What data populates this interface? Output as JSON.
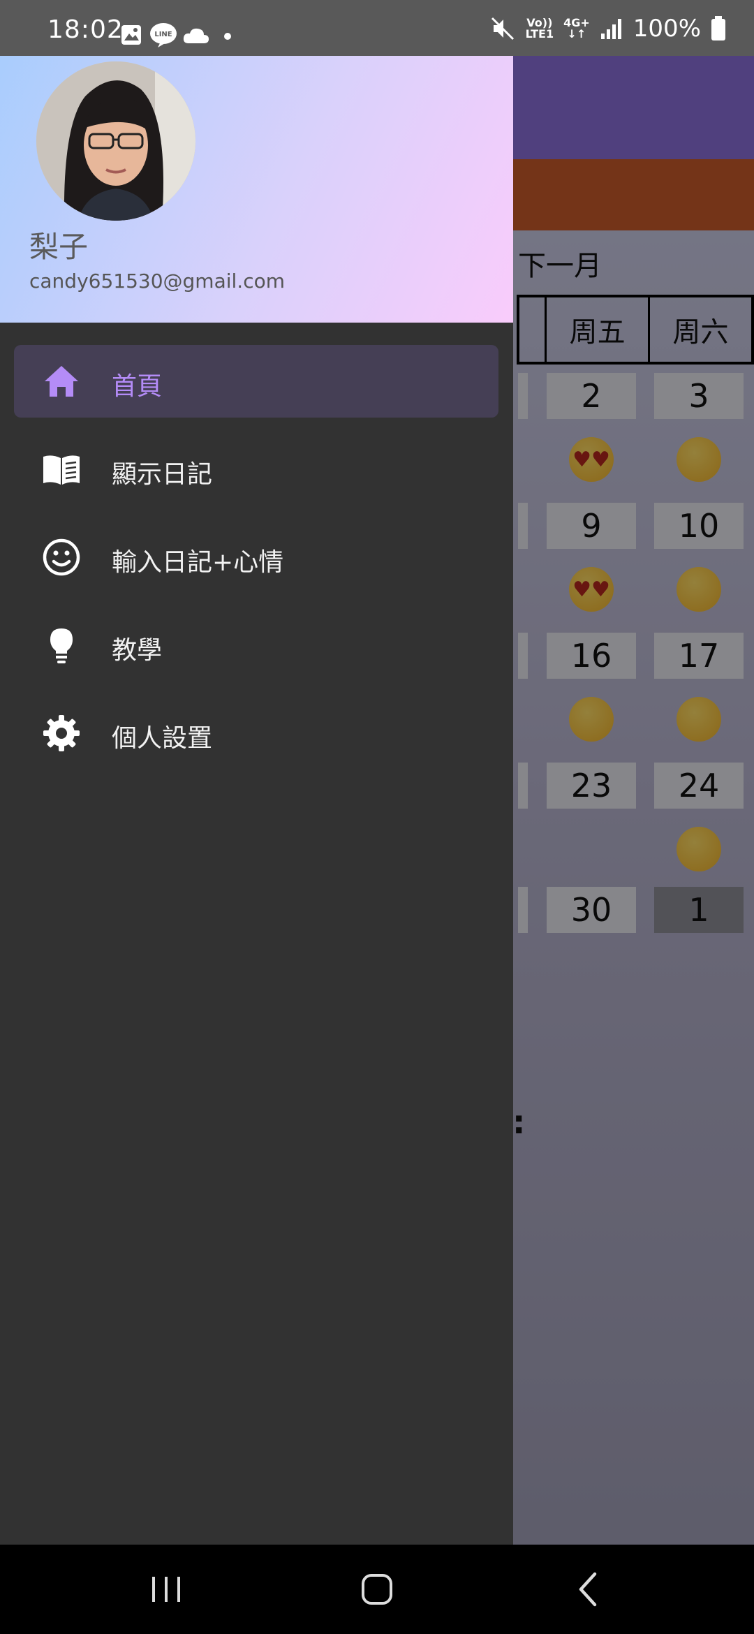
{
  "status_bar": {
    "time": "18:02",
    "network_top": "Vo))",
    "network_bottom": "LTE1",
    "signal_type": "4G+",
    "battery": "100%",
    "icons": [
      "gallery-icon",
      "line-app-icon",
      "cloud-icon",
      "dot-icon",
      "mute-icon",
      "signal-icon",
      "battery-icon"
    ]
  },
  "drawer": {
    "user_name": "梨子",
    "user_email": "candy651530@gmail.com",
    "accent_color": "#b48cf7",
    "items": [
      {
        "label": "首頁",
        "icon": "home-icon",
        "active": true
      },
      {
        "label": "顯示日記",
        "icon": "book-icon",
        "active": false
      },
      {
        "label": "輸入日記+心情",
        "icon": "smiley-icon",
        "active": false
      },
      {
        "label": "教學",
        "icon": "lightbulb-icon",
        "active": false
      },
      {
        "label": "個人設置",
        "icon": "gear-icon",
        "active": false
      }
    ]
  },
  "background_app": {
    "next_month": "下一月",
    "weekdays": [
      "周五",
      "周六"
    ],
    "dates": [
      "2",
      "3",
      "9",
      "10",
      "16",
      "17",
      "23",
      "24",
      "30",
      "1"
    ],
    "dots": ":"
  },
  "nav_bar": {
    "buttons": [
      "recent-apps-icon",
      "home-button-icon",
      "back-icon"
    ]
  }
}
